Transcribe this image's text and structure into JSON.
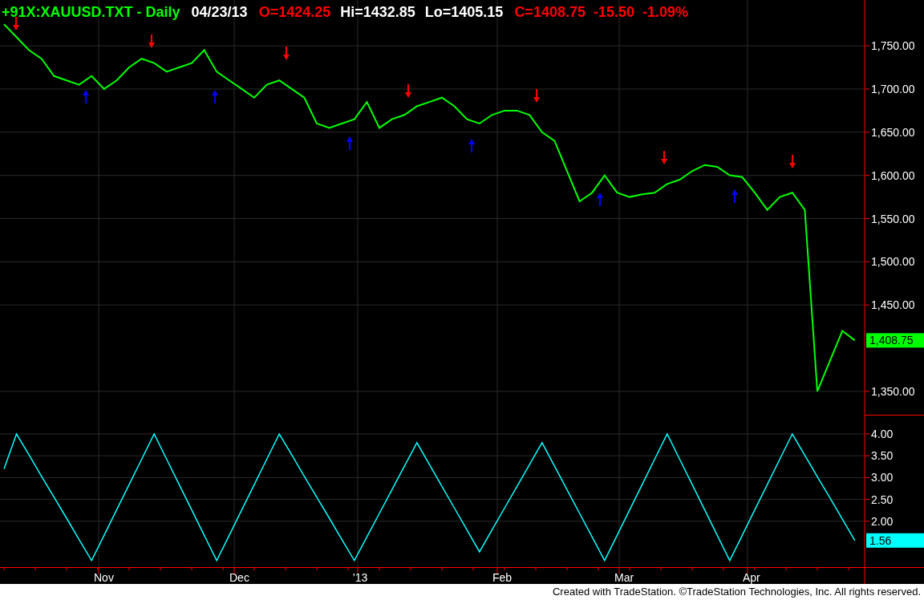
{
  "header": [
    {
      "text": "+91X:XAUUSD.TXT - Daily",
      "color": "#00ff00"
    },
    {
      "text": "04/23/13",
      "color": "#ffffff"
    },
    {
      "text": "O=1424.25",
      "color": "#ff0000"
    },
    {
      "text": "Hi=1432.85",
      "color": "#ffffff"
    },
    {
      "text": "Lo=1405.15",
      "color": "#ffffff"
    },
    {
      "text": "C=1408.75",
      "color": "#ff0000"
    },
    {
      "text": "-15.50",
      "color": "#ff0000"
    },
    {
      "text": "-1.09%",
      "color": "#ff0000"
    }
  ],
  "price_panel": {
    "chart_data": {
      "type": "line",
      "grid": true,
      "ylim": [
        1323,
        1803
      ],
      "series": [
        {
          "color": "#00ff00",
          "values": [
            1775,
            1760,
            1745,
            1735,
            1715,
            1710,
            1705,
            1715,
            1700,
            1710,
            1725,
            1735,
            1730,
            1720,
            1725,
            1730,
            1745,
            1720,
            1710,
            1700,
            1690,
            1705,
            1710,
            1700,
            1690,
            1660,
            1655,
            1660,
            1665,
            1685,
            1655,
            1665,
            1670,
            1680,
            1685,
            1690,
            1680,
            1665,
            1660,
            1670,
            1675,
            1675,
            1670,
            1650,
            1640,
            1605,
            1570,
            1580,
            1600,
            1580,
            1575,
            1578,
            1580,
            1590,
            1595,
            1605,
            1612,
            1610,
            1600,
            1598,
            1580,
            1560,
            1575,
            1580,
            1560,
            1350,
            1385,
            1420,
            1409
          ]
        }
      ],
      "yticks": [
        {
          "value": 1350,
          "label": "1,350.00"
        },
        {
          "value": 1450,
          "label": "1,450.00"
        },
        {
          "value": 1500,
          "label": "1,500.00"
        },
        {
          "value": 1550,
          "label": "1,550.00"
        },
        {
          "value": 1600,
          "label": "1,600.00"
        },
        {
          "value": 1650,
          "label": "1,650.00"
        },
        {
          "value": 1700,
          "label": "1,700.00"
        },
        {
          "value": 1750,
          "label": "1,750.00"
        }
      ]
    },
    "signal_arrows": [
      {
        "kind": "down",
        "color": "#ff0000"
      },
      {
        "kind": "up",
        "color": "#0000ff"
      },
      {
        "kind": "down",
        "color": "#ff0000"
      },
      {
        "kind": "up",
        "color": "#0000ff"
      },
      {
        "kind": "down",
        "color": "#ff0000"
      },
      {
        "kind": "up",
        "color": "#0000ff"
      },
      {
        "kind": "down",
        "color": "#ff0000"
      },
      {
        "kind": "up",
        "color": "#0000ff"
      },
      {
        "kind": "down",
        "color": "#ff0000"
      },
      {
        "kind": "up",
        "color": "#0000ff"
      },
      {
        "kind": "down",
        "color": "#ff0000"
      },
      {
        "kind": "up",
        "color": "#0000ff"
      },
      {
        "kind": "down",
        "color": "#ff0000"
      }
    ],
    "last_value": {
      "text": "1,408.75",
      "color": "#00ff00"
    }
  },
  "oscillator_panel": {
    "chart_data": {
      "type": "line",
      "grid": true,
      "ylim": [
        0.95,
        4.44
      ],
      "series": [
        {
          "color": "#00ffff",
          "values": [
            3.2,
            4.0,
            3.52,
            3.03,
            2.55,
            2.07,
            1.58,
            1.1,
            1.68,
            2.26,
            2.84,
            3.42,
            4.0,
            3.42,
            2.84,
            2.26,
            1.68,
            1.1,
            1.68,
            2.26,
            2.84,
            3.42,
            4.0,
            3.52,
            3.03,
            2.55,
            2.07,
            1.58,
            1.1,
            1.64,
            2.18,
            2.72,
            3.26,
            3.8,
            3.3,
            2.8,
            2.3,
            1.8,
            1.3,
            1.8,
            2.3,
            2.8,
            3.3,
            3.8,
            3.26,
            2.72,
            2.18,
            1.64,
            1.1,
            1.68,
            2.26,
            2.84,
            3.42,
            4.0,
            3.42,
            2.84,
            2.26,
            1.68,
            1.1,
            1.68,
            2.26,
            2.84,
            3.42,
            4.0,
            3.51,
            3.02,
            2.54,
            2.05,
            1.56
          ]
        }
      ],
      "yticks": [
        {
          "value": 2,
          "label": "2.00"
        },
        {
          "value": 2.5,
          "label": "2.50"
        },
        {
          "value": 3,
          "label": "3.00"
        },
        {
          "value": 3.5,
          "label": "3.50"
        },
        {
          "value": 4,
          "label": "4.00"
        }
      ]
    },
    "last_value": {
      "text": "1.56",
      "color": "#00ffff"
    }
  },
  "time_axis": [
    "Nov",
    "Dec",
    "'13",
    "Feb",
    "Mar",
    "Apr"
  ],
  "footer": "Created with TradeStation. ©TradeStation Technologies, Inc. All rights reserved."
}
